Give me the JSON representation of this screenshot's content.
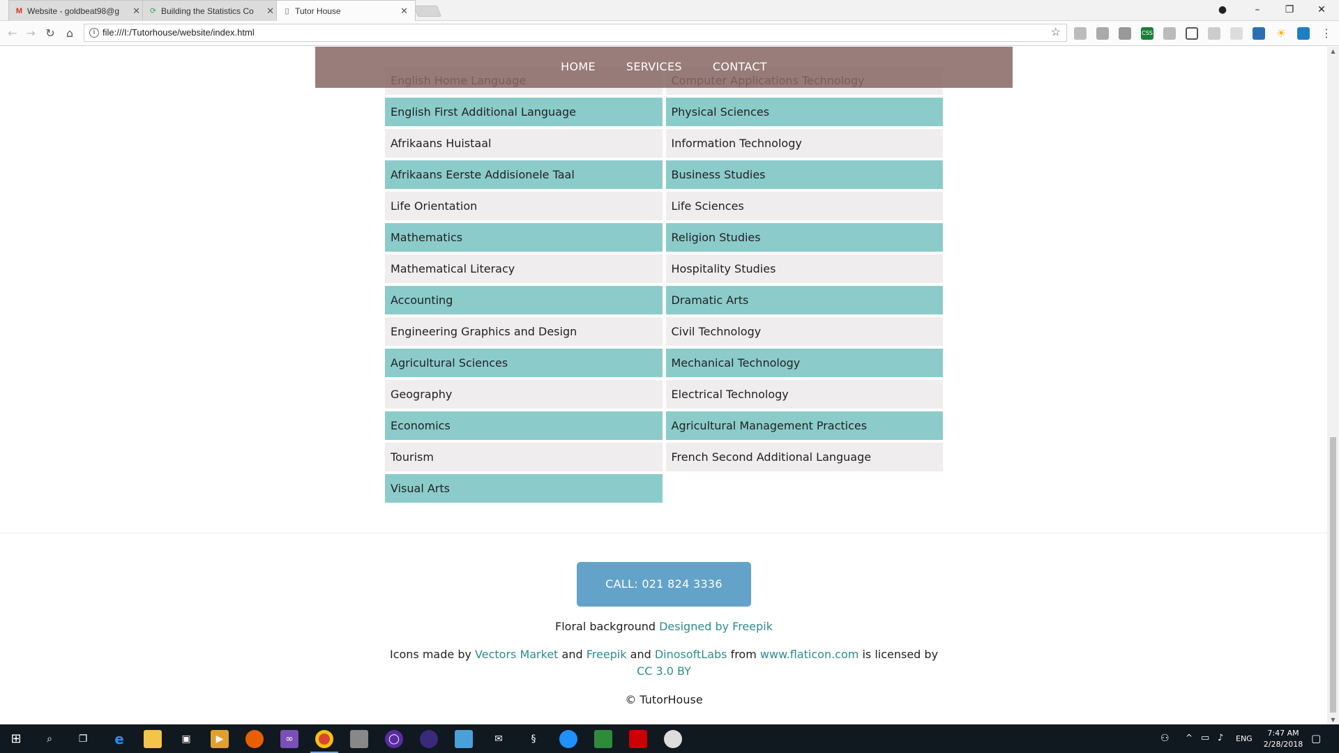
{
  "browser": {
    "tabs": [
      {
        "label": "Website - goldbeat98@g",
        "favicon": "gmail-icon",
        "active": false
      },
      {
        "label": "Building the Statistics Co",
        "favicon": "refresh-icon",
        "active": false
      },
      {
        "label": "Tutor House",
        "favicon": "page-icon",
        "active": true
      }
    ],
    "url": "file:///I:/Tutorhouse/website/index.html"
  },
  "nav": {
    "home": "HOME",
    "services": "SERVICES",
    "contact": "CONTACT"
  },
  "subjects": {
    "rows": [
      [
        "English Home Language",
        "Computer Applications Technology"
      ],
      [
        "English First Additional Language",
        "Physical Sciences"
      ],
      [
        "Afrikaans Huistaal",
        "Information Technology"
      ],
      [
        "Afrikaans Eerste Addisionele Taal",
        "Business Studies"
      ],
      [
        "Life Orientation",
        "Life Sciences"
      ],
      [
        "Mathematics",
        "Religion Studies"
      ],
      [
        "Mathematical Literacy",
        "Hospitality Studies"
      ],
      [
        "Accounting",
        "Dramatic Arts"
      ],
      [
        "Engineering Graphics and Design",
        "Civil Technology"
      ],
      [
        "Agricultural Sciences",
        "Mechanical Technology"
      ],
      [
        "Geography",
        "Electrical Technology"
      ],
      [
        "Economics",
        "Agricultural Management Practices"
      ],
      [
        "Tourism",
        "French Second Additional Language"
      ],
      [
        "Visual Arts",
        ""
      ]
    ]
  },
  "footer": {
    "call_label": "CALL: 021 824 3336",
    "floral_prefix": "Floral background ",
    "floral_link": "Designed by Freepik",
    "icons_prefix": "Icons made by ",
    "vectors_market": "Vectors Market",
    "and1": " and ",
    "freepik": "Freepik",
    "and2": " and ",
    "dinosoft": "DinosoftLabs",
    "from": " from ",
    "flaticon": "www.flaticon.com",
    "licensed": " is licensed by ",
    "cc": "CC 3.0 BY",
    "copyright": "© TutorHouse"
  },
  "taskbar": {
    "language": "ENG",
    "time": "7:47 AM",
    "date": "2/28/2018"
  },
  "colors": {
    "teal_row": "#8bcccb",
    "light_row": "#efeded",
    "nav_bg": "#886864",
    "call_button": "#64a3c9",
    "link": "#2e8b8b"
  }
}
